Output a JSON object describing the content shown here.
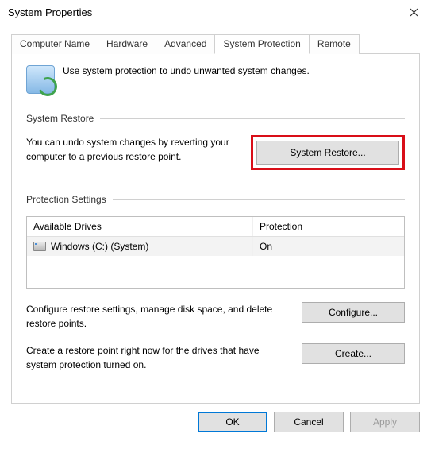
{
  "window": {
    "title": "System Properties"
  },
  "tabs": {
    "items": [
      {
        "label": "Computer Name"
      },
      {
        "label": "Hardware"
      },
      {
        "label": "Advanced"
      },
      {
        "label": "System Protection"
      },
      {
        "label": "Remote"
      }
    ],
    "active_index": 3
  },
  "intro": {
    "text": "Use system protection to undo unwanted system changes."
  },
  "restore_section": {
    "heading": "System Restore",
    "text": "You can undo system changes by reverting your computer to a previous restore point.",
    "button": "System Restore..."
  },
  "protection_section": {
    "heading": "Protection Settings",
    "columns": {
      "drive": "Available Drives",
      "protection": "Protection"
    },
    "rows": [
      {
        "name": "Windows (C:) (System)",
        "protection": "On"
      }
    ],
    "configure_text": "Configure restore settings, manage disk space, and delete restore points.",
    "configure_button": "Configure...",
    "create_text": "Create a restore point right now for the drives that have system protection turned on.",
    "create_button": "Create..."
  },
  "footer": {
    "ok": "OK",
    "cancel": "Cancel",
    "apply": "Apply"
  }
}
